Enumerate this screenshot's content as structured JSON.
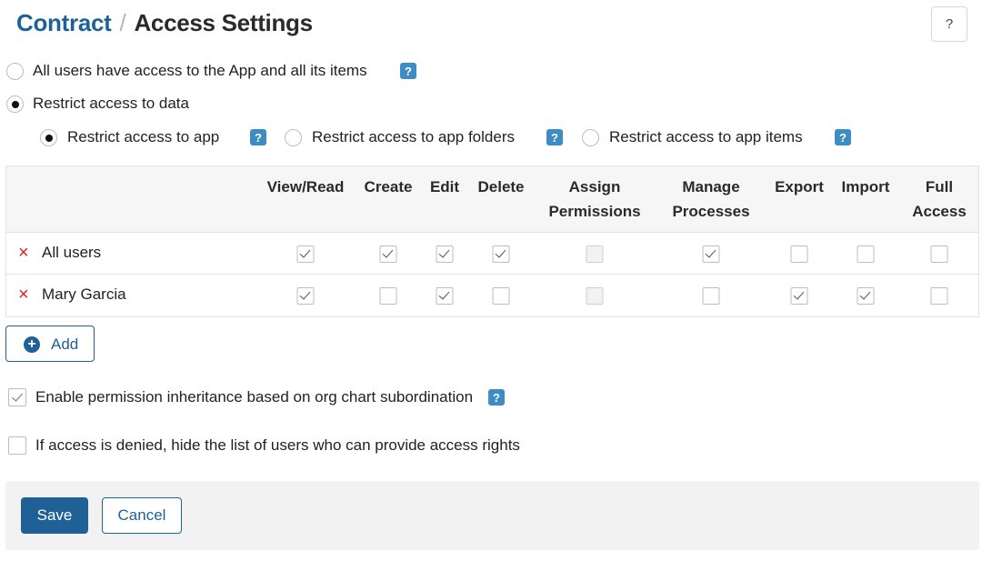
{
  "header": {
    "breadcrumb": "Contract",
    "separator": "/",
    "title": "Access Settings",
    "help_icon": "?"
  },
  "access_mode": {
    "all_users_label": "All users have access to the App and all its items",
    "restrict_label": "Restrict access to data",
    "selected": "restrict"
  },
  "restrict_scope": {
    "app_label": "Restrict access to app",
    "folders_label": "Restrict access to app folders",
    "items_label": "Restrict access to app items",
    "selected": "app"
  },
  "help_badge": "?",
  "permissions": {
    "columns": [
      {
        "line1": "View/Read",
        "line2": ""
      },
      {
        "line1": "Create",
        "line2": ""
      },
      {
        "line1": "Edit",
        "line2": ""
      },
      {
        "line1": "Delete",
        "line2": ""
      },
      {
        "line1": "Assign",
        "line2": "Permissions"
      },
      {
        "line1": "Manage",
        "line2": "Processes"
      },
      {
        "line1": "Export",
        "line2": ""
      },
      {
        "line1": "Import",
        "line2": ""
      },
      {
        "line1": "Full",
        "line2": "Access"
      }
    ],
    "rows": [
      {
        "name": "All users",
        "checks": [
          true,
          true,
          true,
          true,
          false,
          true,
          false,
          false,
          false
        ],
        "disabled": [
          false,
          false,
          false,
          false,
          true,
          false,
          false,
          false,
          false
        ]
      },
      {
        "name": "Mary Garcia",
        "checks": [
          true,
          false,
          true,
          false,
          false,
          false,
          true,
          true,
          false
        ],
        "disabled": [
          false,
          false,
          false,
          false,
          true,
          false,
          false,
          false,
          false
        ]
      }
    ],
    "remove_icon": "×"
  },
  "add_button": {
    "icon": "+",
    "label": "Add"
  },
  "options": {
    "inheritance_label": "Enable permission inheritance based on org chart subordination",
    "inheritance_checked": true,
    "hide_users_label": "If access is denied, hide the list of users who can provide access rights",
    "hide_users_checked": false
  },
  "footer": {
    "save_label": "Save",
    "cancel_label": "Cancel"
  }
}
